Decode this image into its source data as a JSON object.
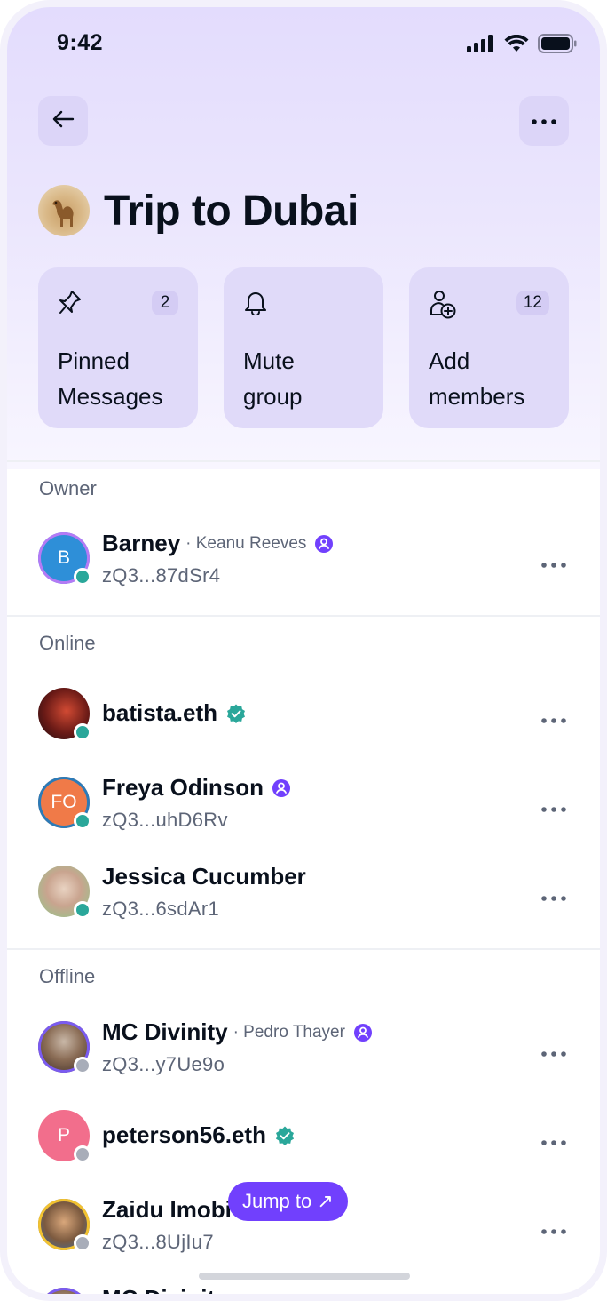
{
  "status_bar": {
    "time": "9:42"
  },
  "header": {
    "title": "Trip to Dubai"
  },
  "actions": [
    {
      "label": "Pinned\nMessages",
      "count": "2",
      "icon": "pin-icon"
    },
    {
      "label": "Mute\ngroup",
      "count": "",
      "icon": "bell-icon"
    },
    {
      "label": "Add\nmembers",
      "count": "12",
      "icon": "add-user-icon"
    }
  ],
  "sections": {
    "owner": "Owner",
    "online": "Online",
    "offline": "Offline"
  },
  "members": {
    "barney": {
      "name": "Barney",
      "nickname": "· Keanu Reeves",
      "address": "zQ3...87dSr4",
      "initials": "B",
      "status": "online"
    },
    "batista": {
      "name": "batista.eth",
      "status": "online"
    },
    "freya": {
      "name": "Freya Odinson",
      "address": "zQ3...uhD6Rv",
      "initials": "FO",
      "status": "online"
    },
    "jessica": {
      "name": "Jessica Cucumber",
      "address": "zQ3...6sdAr1",
      "status": "online"
    },
    "mc": {
      "name": "MC Divinity",
      "nickname": "· Pedro Thayer",
      "address": "zQ3...y7Ue9o",
      "status": "offline"
    },
    "peterson": {
      "name": "peterson56.eth",
      "initials": "P",
      "status": "offline"
    },
    "zaidu": {
      "name": "Zaidu Imobi",
      "address": "zQ3...8UjIu7",
      "status": "offline"
    },
    "mc2": {
      "name": "MC Divinity",
      "status": "offline"
    }
  },
  "jump_to": {
    "label": "Jump to ↗"
  },
  "colors": {
    "accent": "#7140fd",
    "online": "#2aa79a",
    "offline": "#a8adb9",
    "verified": "#2aa79a"
  }
}
